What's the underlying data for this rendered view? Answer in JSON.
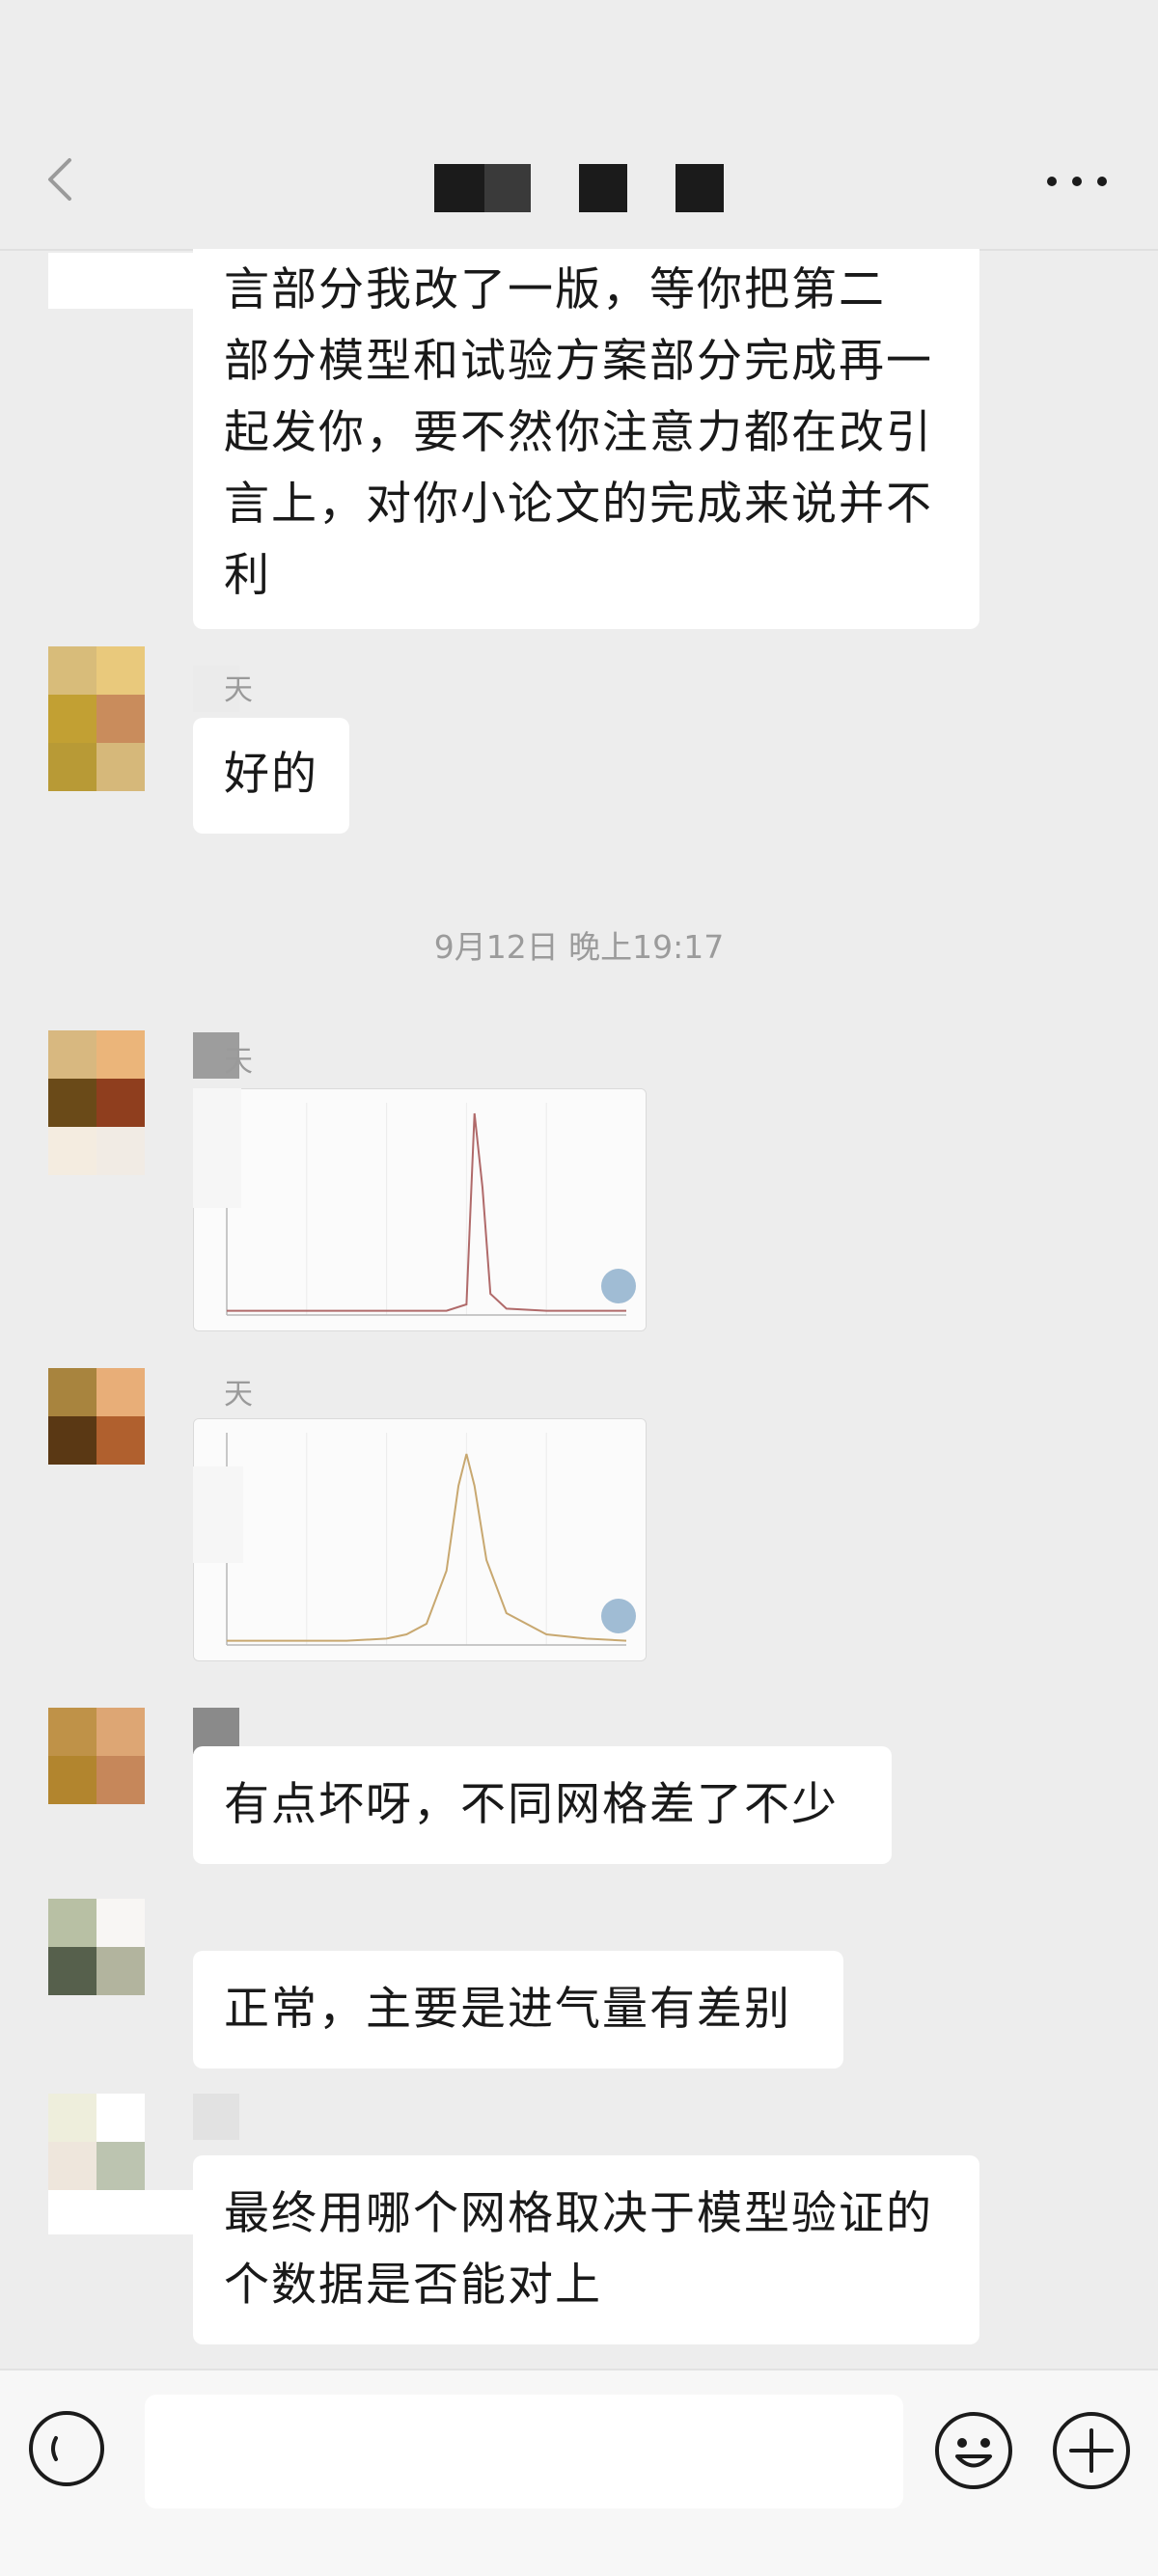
{
  "messages": {
    "m1_text": "言部分我改了一版，等你把第二\n部分模型和试验方案部分完成再一\n起发你，要不然你注意力都在改引\n言上，对你小论文的完成来说并不\n利",
    "m2_sender": "天",
    "m2_text": "好的",
    "timestamp": "9月12日 晚上19:17",
    "m3_sender": "天",
    "m4_sender": "天",
    "m5_text": "有点坏呀，不同网格差了不少",
    "m6_text": "正常，主要是进气量有差别",
    "m7_text": "最终用哪个网格取决于模型验证的\n个数据是否能对上"
  },
  "chart_images": [
    {
      "type": "line",
      "description_peak": "sharp",
      "x": [
        0,
        0.1,
        0.2,
        0.3,
        0.4,
        0.5,
        0.55,
        0.6,
        0.62,
        0.64,
        0.66,
        0.7,
        0.8,
        0.9,
        1.0
      ],
      "y": [
        0.02,
        0.02,
        0.02,
        0.02,
        0.02,
        0.02,
        0.02,
        0.05,
        0.95,
        0.6,
        0.1,
        0.03,
        0.02,
        0.02,
        0.02
      ]
    },
    {
      "type": "line",
      "description_peak": "broad",
      "x": [
        0,
        0.1,
        0.2,
        0.3,
        0.4,
        0.45,
        0.5,
        0.55,
        0.58,
        0.6,
        0.62,
        0.65,
        0.7,
        0.8,
        0.9,
        1.0
      ],
      "y": [
        0.02,
        0.02,
        0.02,
        0.02,
        0.03,
        0.05,
        0.1,
        0.35,
        0.75,
        0.9,
        0.75,
        0.4,
        0.15,
        0.05,
        0.03,
        0.02
      ]
    }
  ],
  "colors": {
    "background": "#ededed",
    "bubble": "#ffffff",
    "text": "#191919",
    "muted": "#9b9b9b",
    "title_block": "#1b1b1b",
    "chart_line_1": "#b06a6a",
    "chart_line_2": "#c8a870"
  },
  "icons": {
    "back": "chevron-left-icon",
    "more": "more-dots-icon",
    "voice": "voice-icon",
    "emoji": "emoji-icon",
    "plus": "plus-icon"
  }
}
